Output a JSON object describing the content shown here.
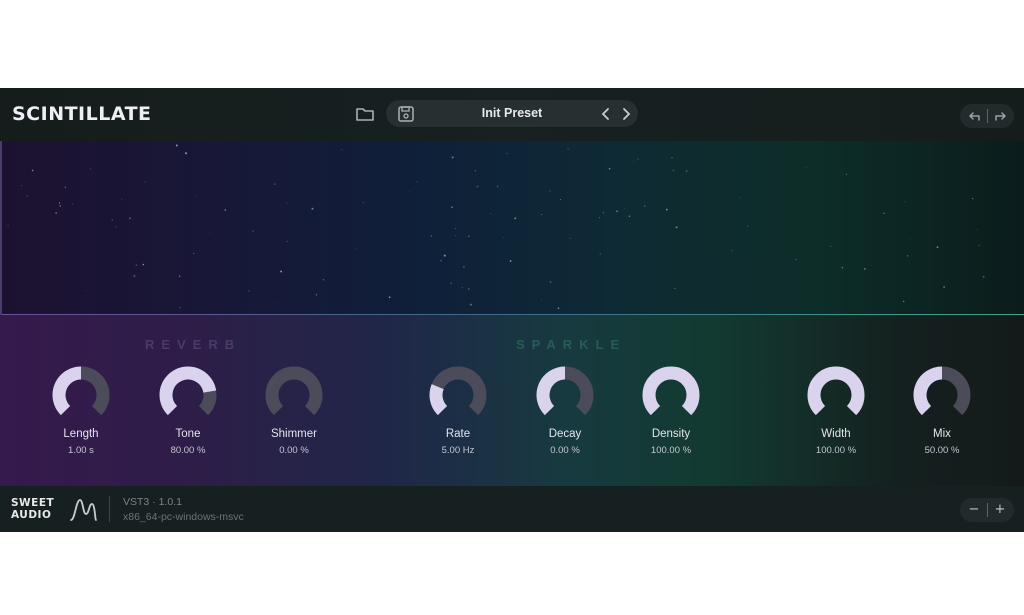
{
  "app": {
    "title": "SCINTILLATE"
  },
  "header": {
    "preset_name": "Init Preset",
    "icons": {
      "folder": "folder-icon",
      "save": "save-icon",
      "prev": "chevron-left-icon",
      "next": "chevron-right-icon",
      "undo": "undo-icon",
      "redo": "redo-icon"
    }
  },
  "sections": {
    "reverb": "REVERB",
    "sparkle": "SPARKLE"
  },
  "knobs": [
    {
      "label": "Length",
      "value": "1.00 s",
      "fraction": 0.5
    },
    {
      "label": "Tone",
      "value": "80.00 %",
      "fraction": 0.8
    },
    {
      "label": "Shimmer",
      "value": "0.00 %",
      "fraction": 0.0
    },
    {
      "label": "Rate",
      "value": "5.00 Hz",
      "fraction": 0.25
    },
    {
      "label": "Decay",
      "value": "0.00 %",
      "fraction": 0.5
    },
    {
      "label": "Density",
      "value": "100.00 %",
      "fraction": 1.0
    },
    {
      "label": "Width",
      "value": "100.00 %",
      "fraction": 1.0
    },
    {
      "label": "Mix",
      "value": "50.00 %",
      "fraction": 0.5
    }
  ],
  "footer": {
    "brand_line1": "SWEET",
    "brand_line2": "AUDIO",
    "format_version": "VST3 · 1.0.1",
    "platform": "x86_64-pc-windows-msvc",
    "zoom_out": "−",
    "zoom_in": "+"
  },
  "colors": {
    "knob_fill": "#d9d3ee",
    "knob_track": "#4b4b5a"
  }
}
